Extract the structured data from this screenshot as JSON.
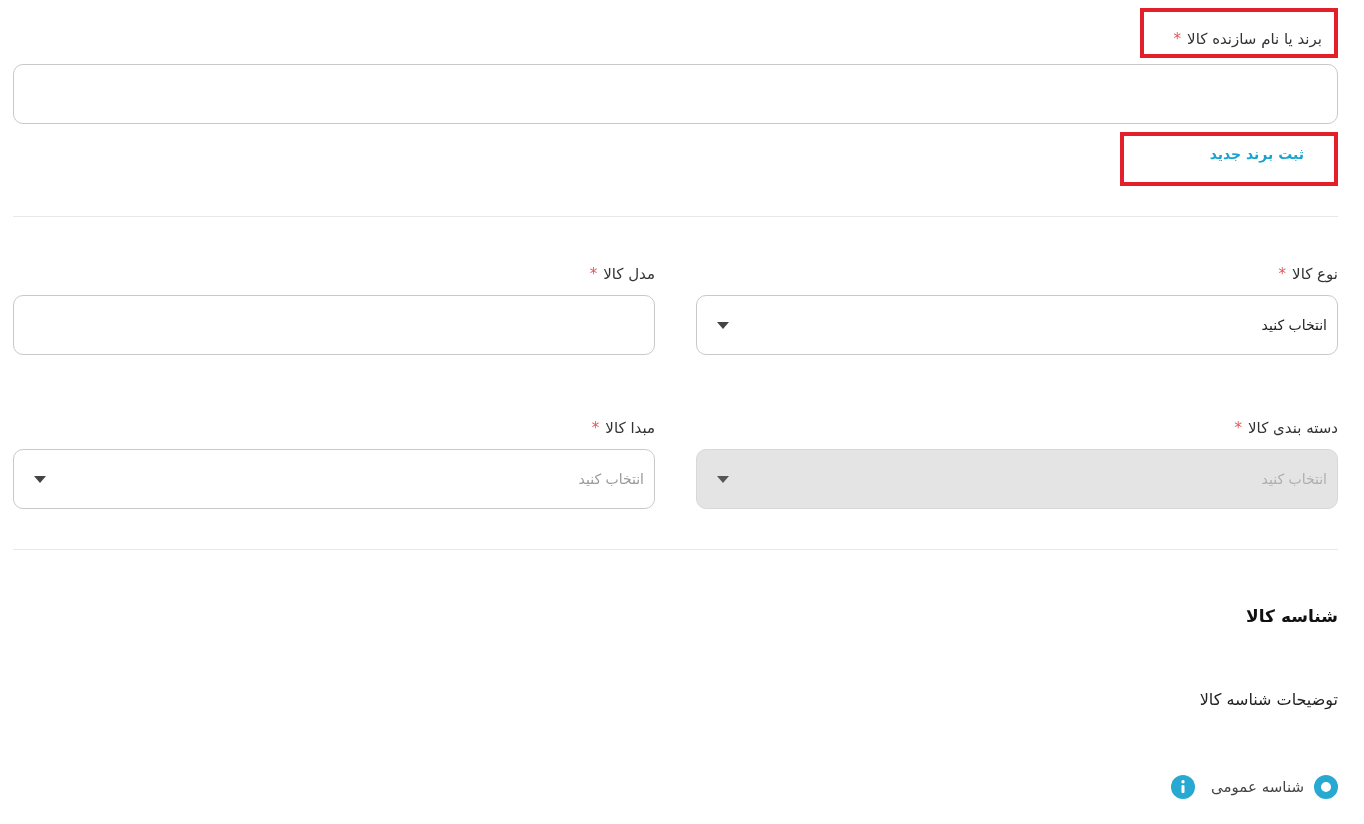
{
  "brand": {
    "label": "برند یا نام سازنده کالا",
    "required_mark": "*",
    "highlighted": true,
    "link": "ثبت برند جدید",
    "link_highlighted": true
  },
  "fields": [
    {
      "kind": "select",
      "label": "نوع کالا",
      "required_mark": "*",
      "value": "انتخاب کنید",
      "disabled": false
    },
    {
      "kind": "text",
      "label": "مدل کالا",
      "required_mark": "*"
    },
    {
      "kind": "select",
      "label": "دسته بندی کالا",
      "required_mark": "*",
      "placeholder": "انتخاب کنید",
      "disabled": true
    },
    {
      "kind": "select",
      "label": "مبدا کالا",
      "required_mark": "*",
      "placeholder": "انتخاب کنید",
      "disabled": false
    }
  ],
  "identifier": {
    "title": "شناسه کالا",
    "description": "توضیحات شناسه کالا",
    "options": [
      {
        "label": "شناسه عمومی",
        "selected": true,
        "info": true
      }
    ]
  }
}
